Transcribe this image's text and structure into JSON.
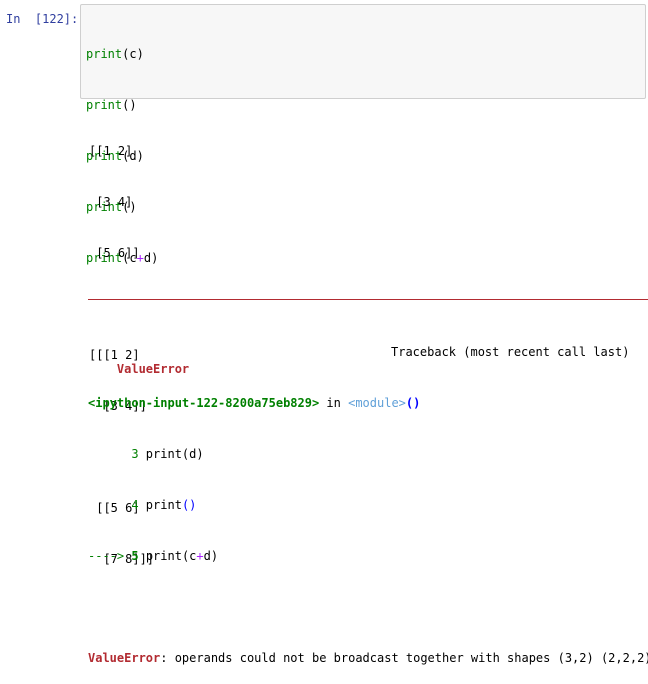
{
  "cell": {
    "prompt": "In  [122]:",
    "code_lines": [
      {
        "func": "print",
        "open": "(",
        "arg": "c",
        "close": ")"
      },
      {
        "func": "print",
        "open": "(",
        "arg": "",
        "close": ")"
      },
      {
        "func": "print",
        "open": "(",
        "arg": "d",
        "close": ")"
      },
      {
        "func": "print",
        "open": "(",
        "arg": "",
        "close": ")"
      },
      {
        "func": "print",
        "open": "(",
        "arg_left": "c",
        "arg_op": "+",
        "arg_right": "d",
        "close": ")"
      }
    ]
  },
  "output": {
    "lines": [
      "[[1 2]",
      " [3 4]",
      " [5 6]]",
      "",
      "[[[1 2]",
      "  [3 4]]",
      "",
      " [[5 6]",
      "  [7 8]]]"
    ]
  },
  "traceback": {
    "error_name": "ValueError",
    "header_right": "Traceback (most recent call last)",
    "file_ref": "<ipython-input-122-8200a75eb829>",
    "in_text": " in ",
    "module": "<module>",
    "call_parens": "()",
    "context_lines": [
      {
        "lineno": "      3",
        "code": " print(d)"
      },
      {
        "lineno": "      4",
        "code_prefix": " print",
        "code_parens": "()"
      }
    ],
    "current_line": {
      "arrow": "----> ",
      "lineno": "5",
      "code_prefix": " print(c",
      "code_op": "+",
      "code_suffix": "d)"
    },
    "final_error_name": "ValueError",
    "final_message": ": operands could not be broadcast together with shapes (3,2) (2,2,2)"
  },
  "colors": {
    "prompt": "#303f9f",
    "builtin": "#008000",
    "operator": "#aa22ff",
    "error": "#b22b31",
    "module": "#60a0d8",
    "cell_bg": "#f7f7f7",
    "cell_border": "#cfcfcf"
  }
}
